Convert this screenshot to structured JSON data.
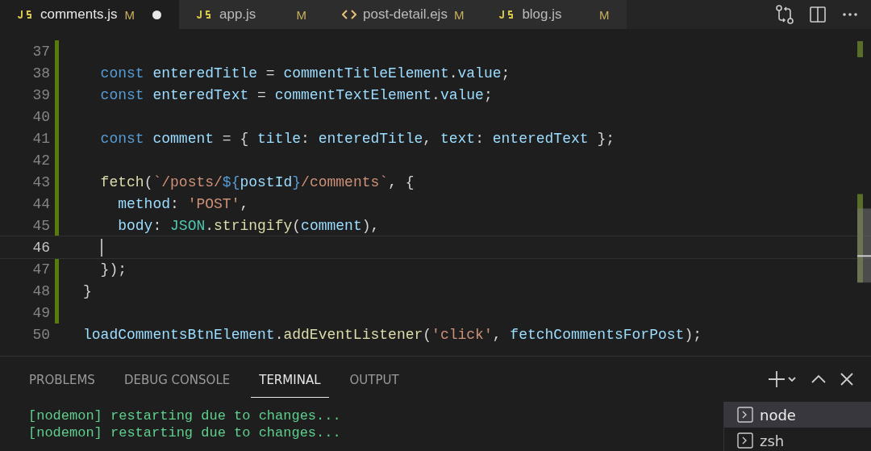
{
  "tabs": [
    {
      "kind": "js",
      "label": "comments.js",
      "badge": "M",
      "dirty": true,
      "selected": true
    },
    {
      "kind": "js",
      "label": "app.js",
      "badge": "M",
      "dirty": false,
      "selected": false
    },
    {
      "kind": "ejs",
      "label": "post-detail.ejs",
      "badge": "M",
      "dirty": false,
      "selected": false
    },
    {
      "kind": "js",
      "label": "blog.js",
      "badge": "M",
      "dirty": false,
      "selected": false
    }
  ],
  "editor": {
    "lines": [
      {
        "number": "37",
        "current": false
      },
      {
        "number": "38",
        "current": false,
        "tokens": [
          {
            "text": "  const ",
            "kind": "kw"
          },
          {
            "text": "enteredTitle",
            "kind": "var"
          },
          {
            "text": " = ",
            "kind": "p"
          },
          {
            "text": "commentTitleElement",
            "kind": "var"
          },
          {
            "text": ".",
            "kind": "p"
          },
          {
            "text": "value",
            "kind": "var"
          },
          {
            "text": ";",
            "kind": "p"
          }
        ]
      },
      {
        "number": "39",
        "current": false,
        "tokens": [
          {
            "text": "  const ",
            "kind": "kw"
          },
          {
            "text": "enteredText",
            "kind": "var"
          },
          {
            "text": " = ",
            "kind": "p"
          },
          {
            "text": "commentTextElement",
            "kind": "var"
          },
          {
            "text": ".",
            "kind": "p"
          },
          {
            "text": "value",
            "kind": "var"
          },
          {
            "text": ";",
            "kind": "p"
          }
        ]
      },
      {
        "number": "40",
        "current": false
      },
      {
        "number": "41",
        "current": false,
        "tokens": [
          {
            "text": "  const ",
            "kind": "kw"
          },
          {
            "text": "comment",
            "kind": "var"
          },
          {
            "text": " = { ",
            "kind": "p"
          },
          {
            "text": "title",
            "kind": "var"
          },
          {
            "text": ": ",
            "kind": "p"
          },
          {
            "text": "enteredTitle",
            "kind": "var"
          },
          {
            "text": ", ",
            "kind": "p"
          },
          {
            "text": "text",
            "kind": "var"
          },
          {
            "text": ": ",
            "kind": "p"
          },
          {
            "text": "enteredText",
            "kind": "var"
          },
          {
            "text": " };",
            "kind": "p"
          }
        ]
      },
      {
        "number": "42",
        "current": false
      },
      {
        "number": "43",
        "current": false,
        "tokens": [
          {
            "text": "  fetch",
            "kind": "fn"
          },
          {
            "text": "(",
            "kind": "p"
          },
          {
            "text": "`/posts/",
            "kind": "str"
          },
          {
            "text": "${",
            "kind": "kw"
          },
          {
            "text": "postId",
            "kind": "var"
          },
          {
            "text": "}",
            "kind": "kw"
          },
          {
            "text": "/comments`",
            "kind": "str"
          },
          {
            "text": ", {",
            "kind": "p"
          }
        ]
      },
      {
        "number": "44",
        "current": false,
        "tokens": [
          {
            "text": "    method",
            "kind": "var"
          },
          {
            "text": ": ",
            "kind": "p"
          },
          {
            "text": "'POST'",
            "kind": "str"
          },
          {
            "text": ",",
            "kind": "p"
          }
        ]
      },
      {
        "number": "45",
        "current": false,
        "tokens": [
          {
            "text": "    body",
            "kind": "var"
          },
          {
            "text": ": ",
            "kind": "p"
          },
          {
            "text": "JSON",
            "kind": "cls"
          },
          {
            "text": ".",
            "kind": "p"
          },
          {
            "text": "stringify",
            "kind": "fn"
          },
          {
            "text": "(",
            "kind": "p"
          },
          {
            "text": "comment",
            "kind": "var"
          },
          {
            "text": "),",
            "kind": "p"
          }
        ]
      },
      {
        "number": "46",
        "current": true
      },
      {
        "number": "47",
        "current": false,
        "tokens": [
          {
            "text": "  });",
            "kind": "p"
          }
        ]
      },
      {
        "number": "48",
        "current": false,
        "tokens": [
          {
            "text": "}",
            "kind": "p"
          }
        ]
      },
      {
        "number": "49",
        "current": false
      },
      {
        "number": "50",
        "current": false,
        "tokens": [
          {
            "text": "loadCommentsBtnElement",
            "kind": "var"
          },
          {
            "text": ".",
            "kind": "p"
          },
          {
            "text": "addEventListener",
            "kind": "fn"
          },
          {
            "text": "(",
            "kind": "p"
          },
          {
            "text": "'click'",
            "kind": "str"
          },
          {
            "text": ", ",
            "kind": "p"
          },
          {
            "text": "fetchCommentsForPost",
            "kind": "var"
          },
          {
            "text": ");",
            "kind": "p"
          }
        ]
      }
    ]
  },
  "panel": {
    "tabs": [
      {
        "label": "PROBLEMS",
        "selected": false
      },
      {
        "label": "DEBUG CONSOLE",
        "selected": false
      },
      {
        "label": "TERMINAL",
        "selected": true
      },
      {
        "label": "OUTPUT",
        "selected": false
      }
    ],
    "terminal_lines": [
      "[nodemon] restarting due to changes...",
      "[nodemon] restarting due to changes..."
    ],
    "terminals": [
      {
        "label": "node",
        "selected": true
      },
      {
        "label": "zsh",
        "selected": false
      }
    ]
  }
}
